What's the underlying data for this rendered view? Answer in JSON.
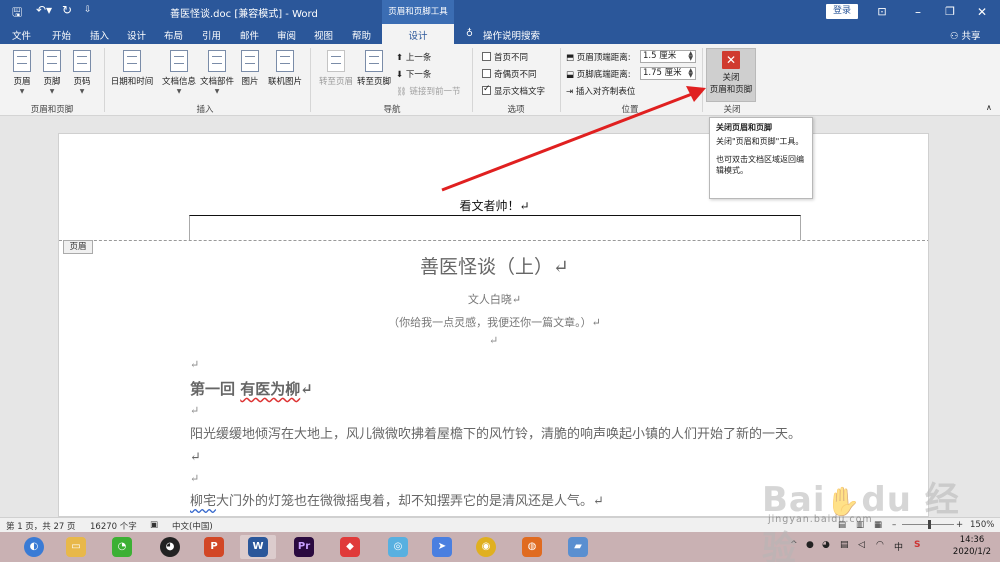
{
  "titlebar": {
    "doc_title": "善医怪谈.doc [兼容模式] - Word",
    "context_tab_group": "页眉和页脚工具",
    "login": "登录",
    "save_icon": "save-icon",
    "undo_icon": "undo-icon",
    "redo_icon": "redo-icon",
    "customize_icon": "customize-icon"
  },
  "tabs": [
    "文件",
    "开始",
    "插入",
    "设计",
    "布局",
    "引用",
    "邮件",
    "审阅",
    "视图",
    "帮助"
  ],
  "active_tab": "设计",
  "tell_me": "操作说明搜索",
  "share": "共享",
  "ribbon": {
    "header_footer": {
      "group_label": "页眉和页脚",
      "header": "页眉",
      "footer": "页脚",
      "page_number": "页码"
    },
    "insert": {
      "group_label": "插入",
      "date_time": "日期和时间",
      "doc_info": "文档信息",
      "doc_parts": "文档部件",
      "picture": "图片",
      "online_picture": "联机图片"
    },
    "navigation": {
      "group_label": "导航",
      "goto_header": "转至页眉",
      "goto_footer": "转至页脚",
      "previous": "上一条",
      "next": "下一条",
      "link_previous": "链接到前一节"
    },
    "options": {
      "group_label": "选项",
      "first_page_diff": "首页不同",
      "odd_even_diff": "奇偶页不同",
      "show_doc_text": "显示文档文字"
    },
    "position": {
      "group_label": "位置",
      "header_from_top_label": "页眉顶端距离:",
      "header_from_top_value": "1.5 厘米",
      "footer_from_bottom_label": "页脚底端距离:",
      "footer_from_bottom_value": "1.75 厘米",
      "insert_align_tab": "插入对齐制表位"
    },
    "close": {
      "group_label": "关闭",
      "line1": "关闭",
      "line2": "页眉和页脚"
    }
  },
  "tooltip": {
    "title": "关闭页眉和页脚",
    "body": "关闭\"页眉和页脚\"工具。",
    "hint": "也可双击文档区域返回编辑模式。"
  },
  "document": {
    "header_text": "看文者帅！↵",
    "header_tag": "页眉",
    "title": "善医怪谈（上）↵",
    "author": "文人白晓↵",
    "motto": "（你给我一点灵感，我便还你一篇文章。）↵",
    "para_mark": "↵",
    "chapter": "第一回  有医为柳↵",
    "chapter_plain": "第一回  ",
    "chapter_squiggle": "有医为柳",
    "para1": "阳光缓缓地倾泻在大地上，风儿微微吹拂着屋檐下的风竹铃，清脆的响声唤起小镇的人们开始了新的一天。↵",
    "para2_squiggle": "柳宅",
    "para2_rest": "大门外的灯笼也在微微摇曳着，却不知摆弄它的是清风还是人气。↵"
  },
  "statusbar": {
    "page": "第 1 页，共 27 页",
    "words": "16270 个字",
    "language": "中文(中国)",
    "zoom": "150%"
  },
  "taskbar": {
    "time": "14:36",
    "date": "2020/1/2"
  },
  "watermark": {
    "logo": "Baidu 经验",
    "url": "jingyan.baidu.com"
  },
  "colors": {
    "word_blue": "#2b579a",
    "close_red": "#d03b2f",
    "arrow_red": "#e02020"
  }
}
